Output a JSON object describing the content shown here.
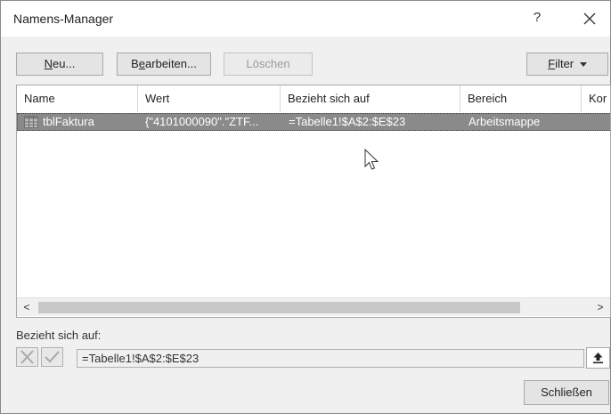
{
  "dialog": {
    "title": "Namens-Manager",
    "help_label": "?"
  },
  "toolbar": {
    "new_label": {
      "accel": "N",
      "rest": "eu..."
    },
    "edit_label": {
      "pre": "B",
      "accel": "e",
      "rest": "arbeiten..."
    },
    "delete_label": "Löschen",
    "filter_label": {
      "accel": "F",
      "rest": "ilter"
    }
  },
  "table": {
    "headers": [
      "Name",
      "Wert",
      "Bezieht sich auf",
      "Bereich",
      "Kor"
    ],
    "rows": [
      {
        "name": "tblFaktura",
        "value": "{\"4101000090\".\"ZTF...",
        "refers_to": "=Tabelle1!$A$2:$E$23",
        "scope": "Arbeitsmappe"
      }
    ]
  },
  "scrollbar": {
    "left_arrow": "<",
    "right_arrow": ">"
  },
  "refers_to": {
    "label": "Bezieht sich auf:",
    "value": "=Tabelle1!$A$2:$E$23"
  },
  "footer": {
    "close_label": "Schließen"
  }
}
